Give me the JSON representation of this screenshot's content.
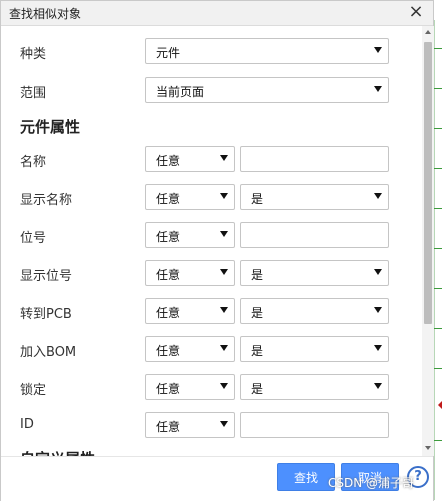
{
  "dialog": {
    "title": "查找相似对象",
    "close_glyph": "×"
  },
  "fields": {
    "type": {
      "label": "种类",
      "value": "元件"
    },
    "scope": {
      "label": "范围",
      "value": "当前页面"
    }
  },
  "sections": {
    "component_properties": "元件属性",
    "custom_properties": "自定义属性"
  },
  "properties": [
    {
      "label": "名称",
      "condition": "任意",
      "value": ""
    },
    {
      "label": "显示名称",
      "condition": "任意",
      "value": "是"
    },
    {
      "label": "位号",
      "condition": "任意",
      "value": ""
    },
    {
      "label": "显示位号",
      "condition": "任意",
      "value": "是"
    },
    {
      "label": "转到PCB",
      "condition": "任意",
      "value": "是"
    },
    {
      "label": "加入BOM",
      "condition": "任意",
      "value": "是"
    },
    {
      "label": "锁定",
      "condition": "任意",
      "value": "是"
    },
    {
      "label": "ID",
      "condition": "任意",
      "value": ""
    }
  ],
  "footer": {
    "find_label": "查找",
    "cancel_label": "取消",
    "help_glyph": "?"
  },
  "watermark": "CSDN @浦子哥",
  "colors": {
    "primary": "#4d90fe",
    "titlebar": "#f1f1f1"
  }
}
